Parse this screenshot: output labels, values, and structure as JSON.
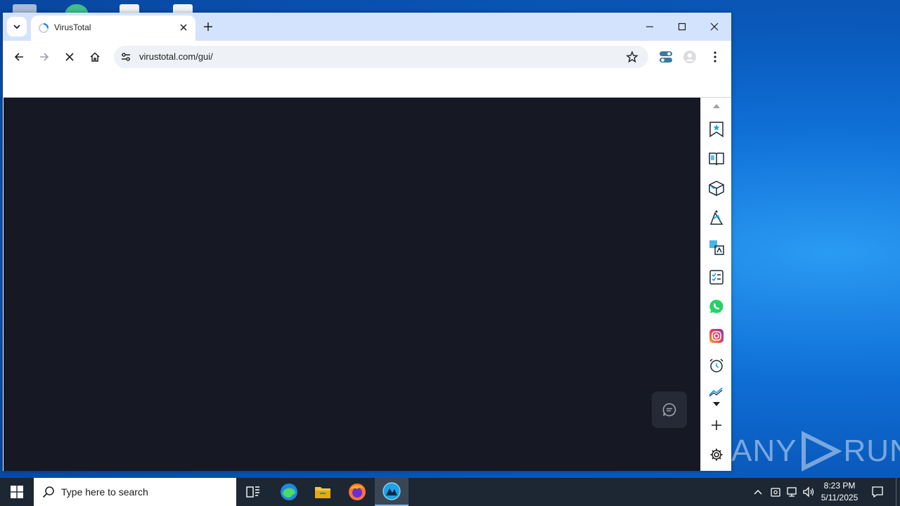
{
  "browser": {
    "tab": {
      "title": "VirusTotal"
    },
    "address_bar": {
      "url": "virustotal.com/gui/"
    }
  },
  "taskbar": {
    "search_placeholder": "Type here to search",
    "clock": {
      "time": "8:23 PM",
      "date": "5/11/2025"
    }
  },
  "watermark": {
    "text": "ANY",
    "text2": "RUN"
  },
  "sidepanel": {
    "icons": [
      "bookmarks-icon",
      "reading-list-icon",
      "package-icon",
      "shopping-icon",
      "translate-icon",
      "checklist-icon",
      "whatsapp-icon",
      "instagram-icon",
      "alarm-icon",
      "trend-icon"
    ]
  },
  "colors": {
    "viewport_bg": "#161824",
    "tabbar_bg": "#d3e3fd",
    "taskbar_bg": "#1c2733",
    "desktop_accent": "#0f6fd6"
  }
}
